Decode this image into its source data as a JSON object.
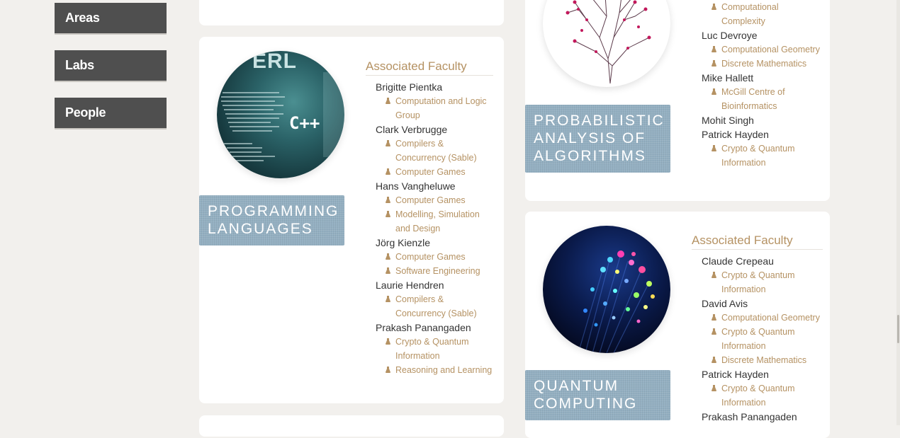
{
  "nav": {
    "items": [
      {
        "label": "Areas"
      },
      {
        "label": "Labs"
      },
      {
        "label": "People"
      }
    ]
  },
  "cards": {
    "programming": {
      "title": "Programming Languages",
      "faculty_heading": "Associated Faculty",
      "faculty": [
        {
          "name": "Brigitte Pientka",
          "labs": [
            "Computation and Logic Group"
          ]
        },
        {
          "name": "Clark Verbrugge",
          "labs": [
            "Compilers & Concurrency (Sable)",
            "Computer Games"
          ]
        },
        {
          "name": "Hans Vangheluwe",
          "labs": [
            "Computer Games",
            "Modelling, Simulation and Design"
          ]
        },
        {
          "name": "Jörg Kienzle",
          "labs": [
            "Computer Games",
            "Software Engineering"
          ]
        },
        {
          "name": "Laurie Hendren",
          "labs": [
            "Compilers & Concurrency (Sable)"
          ]
        },
        {
          "name": "Prakash Panangaden",
          "labs": [
            "Crypto & Quantum Information",
            "Reasoning and Learning"
          ]
        }
      ]
    },
    "probabilistic": {
      "title": "Probabilistic Analysis of Algorithms",
      "faculty": [
        {
          "name": "",
          "labs": [
            "Computational Complexity"
          ]
        },
        {
          "name": "Luc Devroye",
          "labs": [
            "Computational Geometry",
            "Discrete Mathematics"
          ]
        },
        {
          "name": "Mike Hallett",
          "labs": [
            "McGill Centre of Bioinformatics"
          ]
        },
        {
          "name": "Mohit Singh",
          "labs": []
        },
        {
          "name": "Patrick Hayden",
          "labs": [
            "Crypto & Quantum Information"
          ]
        }
      ]
    },
    "quantum": {
      "title": "Quantum Computing",
      "faculty_heading": "Associated Faculty",
      "faculty": [
        {
          "name": "Claude Crepeau",
          "labs": [
            "Crypto & Quantum Information"
          ]
        },
        {
          "name": "David Avis",
          "labs": [
            "Computational Geometry",
            "Crypto & Quantum Information",
            "Discrete Mathematics"
          ]
        },
        {
          "name": "Patrick Hayden",
          "labs": [
            "Crypto & Quantum Information"
          ]
        },
        {
          "name": "Prakash Panangaden",
          "labs": []
        }
      ]
    }
  },
  "image_text": {
    "perl": "ERL",
    "cpp": "C++"
  },
  "colors": {
    "nav_bg": "#4f4f4f",
    "accent": "#b59263",
    "label_blue": "#93afc1",
    "page_bg": "#f2f0ed"
  }
}
